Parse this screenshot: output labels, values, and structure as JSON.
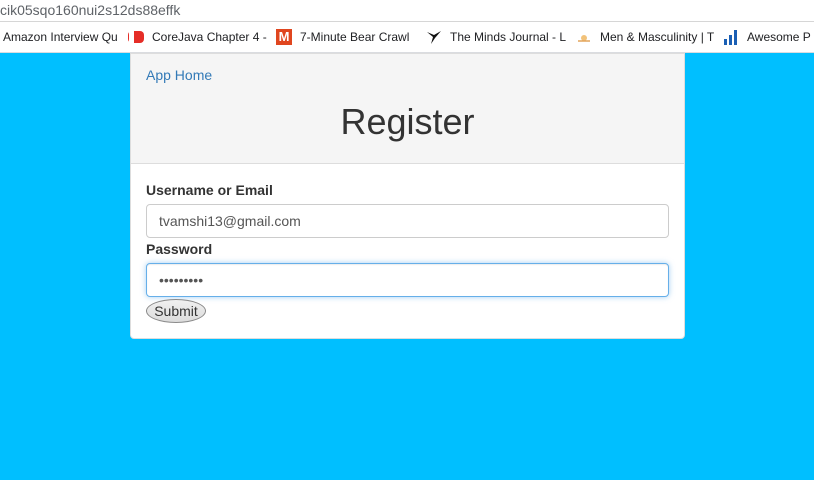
{
  "browser": {
    "url_fragment": "cik05sqo160nui2s12ds88effk",
    "bookmarks": [
      {
        "label": "Amazon Interview Qu",
        "icon": "document-icon"
      },
      {
        "label": "CoreJava Chapter 4 -",
        "icon": "youtube-icon"
      },
      {
        "label": "7-Minute Bear Crawl",
        "icon": "m-logo-icon"
      },
      {
        "label": "The Minds Journal - L",
        "icon": "bird-icon"
      },
      {
        "label": "Men & Masculinity | T",
        "icon": "sun-logo-icon"
      },
      {
        "label": "Awesome P",
        "icon": "bar-chart-icon"
      }
    ]
  },
  "header": {
    "app_home_link": "App Home",
    "title": "Register"
  },
  "form": {
    "username_label": "Username or Email",
    "username_value": "tvamshi13@gmail.com",
    "password_label": "Password",
    "password_masked": "•••••••••",
    "submit_label": "Submit"
  },
  "colors": {
    "background": "#00bfff",
    "link": "#337ab7",
    "focus_border": "#66afe9"
  }
}
